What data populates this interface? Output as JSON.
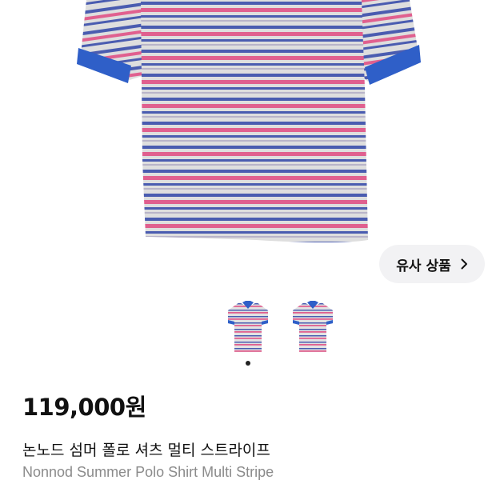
{
  "product": {
    "price": "119,000원",
    "title_ko": "논노드 섬머 폴로 셔츠 멀티 스트라이프",
    "title_en": "Nonnod Summer Polo Shirt Multi Stripe"
  },
  "similar_button": {
    "label": "유사 상품",
    "icon": "chevron-right-icon"
  },
  "gallery": {
    "thumbnails": [
      "shirt-front-thumbnail",
      "shirt-back-thumbnail"
    ],
    "active_index": 0
  },
  "colors": {
    "stripe_pink": "#e0608f",
    "stripe_blue": "#4a5cb0",
    "base_gray": "#dcdcdc",
    "cuff_blue": "#2f5fc8",
    "button_bg": "#f2f2f4",
    "subtitle_gray": "#8b8b8b"
  }
}
